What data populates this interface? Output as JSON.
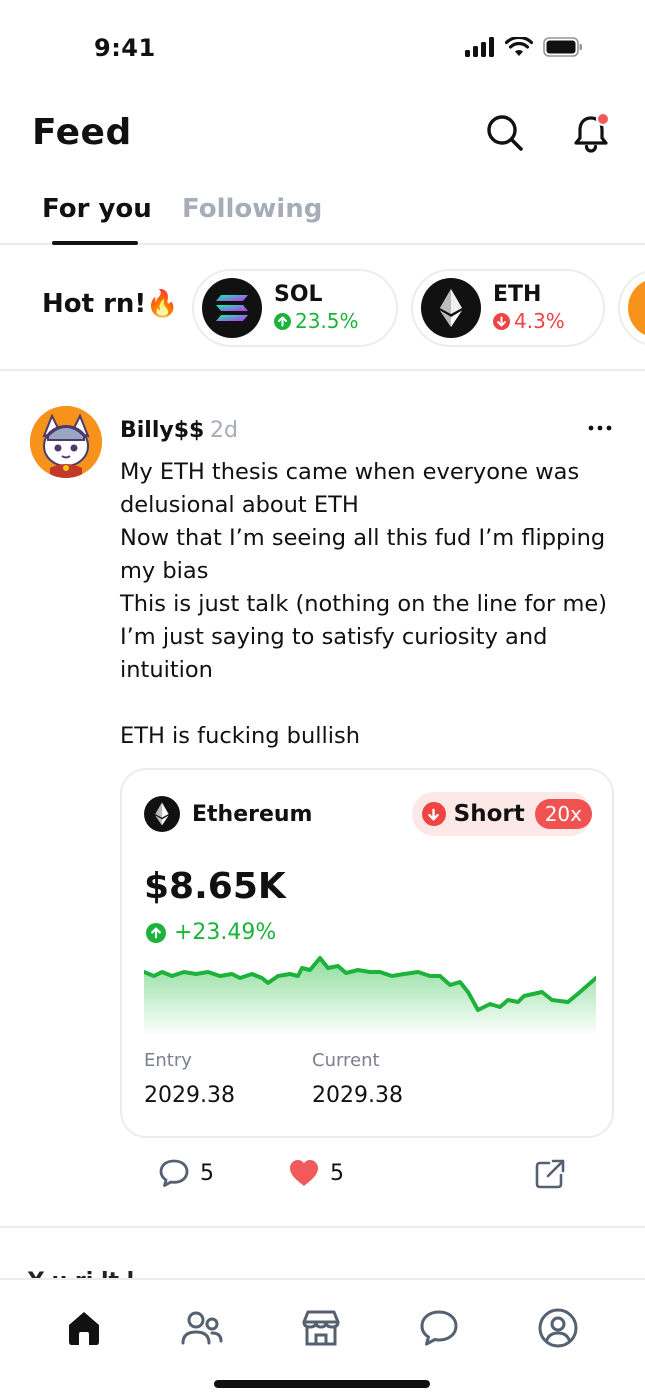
{
  "status_bar": {
    "time": "9:41"
  },
  "header": {
    "title": "Feed"
  },
  "tabs": [
    {
      "label": "For you",
      "active": true
    },
    {
      "label": "Following",
      "active": false
    }
  ],
  "hot": {
    "label": "Hot rn!🔥",
    "coins": [
      {
        "symbol": "SOL",
        "change": "23.5%",
        "direction": "up"
      },
      {
        "symbol": "ETH",
        "change": "4.3%",
        "direction": "down"
      }
    ]
  },
  "post": {
    "author": "Billy$$",
    "time": "2d",
    "lines": [
      "My ETH thesis came when everyone was",
      "delusional about ETH",
      "Now that I’m seeing all this fud I’m flipping",
      "my bias",
      "This is just talk (nothing on the line for me)",
      "I’m just saying to satisfy curiosity and",
      "intuition",
      "",
      "ETH is fucking bullish"
    ],
    "trade": {
      "asset": "Ethereum",
      "position": "Short",
      "leverage": "20x",
      "price": "$8.65K",
      "change": "+23.49%",
      "entry_label": "Entry",
      "entry_value": "2029.38",
      "current_label": "Current",
      "current_value": "2029.38"
    },
    "comments": "5",
    "likes": "5"
  },
  "next_post": {
    "peek_text": "Y u ri lt l"
  },
  "colors": {
    "up": "#1db33b",
    "down": "#ef4444",
    "accent_red": "#f05252",
    "muted": "#a7adb8"
  },
  "nav": [
    "home-icon",
    "friends-icon",
    "store-icon",
    "chat-icon",
    "profile-icon"
  ]
}
